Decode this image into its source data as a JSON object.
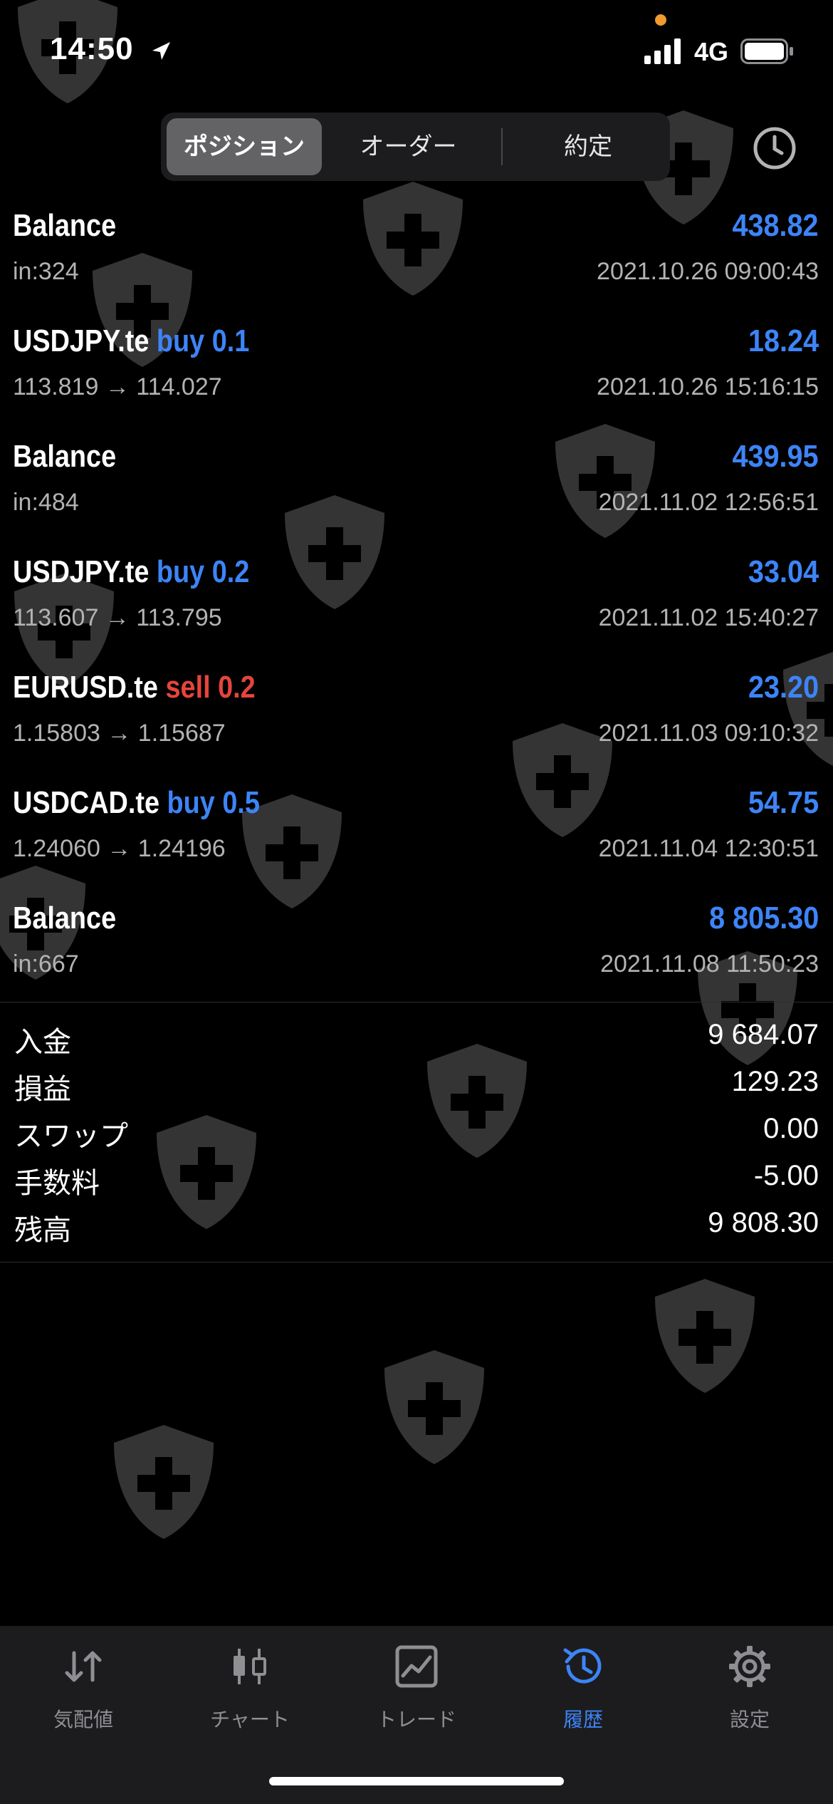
{
  "status_bar": {
    "time": "14:50",
    "network": "4G",
    "icons": [
      "location-arrow-icon",
      "cellular-signal-icon",
      "battery-icon"
    ]
  },
  "segments": [
    {
      "label": "ポジション",
      "active": true
    },
    {
      "label": "オーダー",
      "active": false
    },
    {
      "label": "約定",
      "active": false
    }
  ],
  "history_rows": [
    {
      "symbol": "Balance",
      "side": "",
      "detail": "in:324",
      "value": "438.82",
      "datetime": "2021.10.26 09:00:43"
    },
    {
      "symbol": "USDJPY.te",
      "side": "buy 0.1",
      "side_type": "buy",
      "detail": "113.819 → 114.027",
      "value": "18.24",
      "datetime": "2021.10.26 15:16:15"
    },
    {
      "symbol": "Balance",
      "side": "",
      "detail": "in:484",
      "value": "439.95",
      "datetime": "2021.11.02 12:56:51"
    },
    {
      "symbol": "USDJPY.te",
      "side": "buy 0.2",
      "side_type": "buy",
      "detail": "113.607 → 113.795",
      "value": "33.04",
      "datetime": "2021.11.02 15:40:27"
    },
    {
      "symbol": "EURUSD.te",
      "side": "sell 0.2",
      "side_type": "sell",
      "detail": "1.15803 → 1.15687",
      "value": "23.20",
      "datetime": "2021.11.03 09:10:32"
    },
    {
      "symbol": "USDCAD.te",
      "side": "buy 0.5",
      "side_type": "buy",
      "detail": "1.24060 → 1.24196",
      "value": "54.75",
      "datetime": "2021.11.04 12:30:51"
    },
    {
      "symbol": "Balance",
      "side": "",
      "detail": "in:667",
      "value": "8 805.30",
      "datetime": "2021.11.08 11:50:23"
    }
  ],
  "summary": [
    {
      "label": "入金",
      "value": "9 684.07"
    },
    {
      "label": "損益",
      "value": "129.23"
    },
    {
      "label": "スワップ",
      "value": "0.00"
    },
    {
      "label": "手数料",
      "value": "-5.00"
    },
    {
      "label": "残高",
      "value": "9 808.30"
    }
  ],
  "tabs": [
    {
      "label": "気配値",
      "icon": "quotes-arrows-icon",
      "active": false
    },
    {
      "label": "チャート",
      "icon": "chart-candles-icon",
      "active": false
    },
    {
      "label": "トレード",
      "icon": "trade-chart-icon",
      "active": false
    },
    {
      "label": "履歴",
      "icon": "history-clock-icon",
      "active": true
    },
    {
      "label": "設定",
      "icon": "gear-icon",
      "active": false
    }
  ],
  "colors": {
    "accent_blue": "#3d84f7",
    "sell_red": "#e5453c",
    "background": "#000000",
    "tabbar": "#1c1c1e"
  }
}
